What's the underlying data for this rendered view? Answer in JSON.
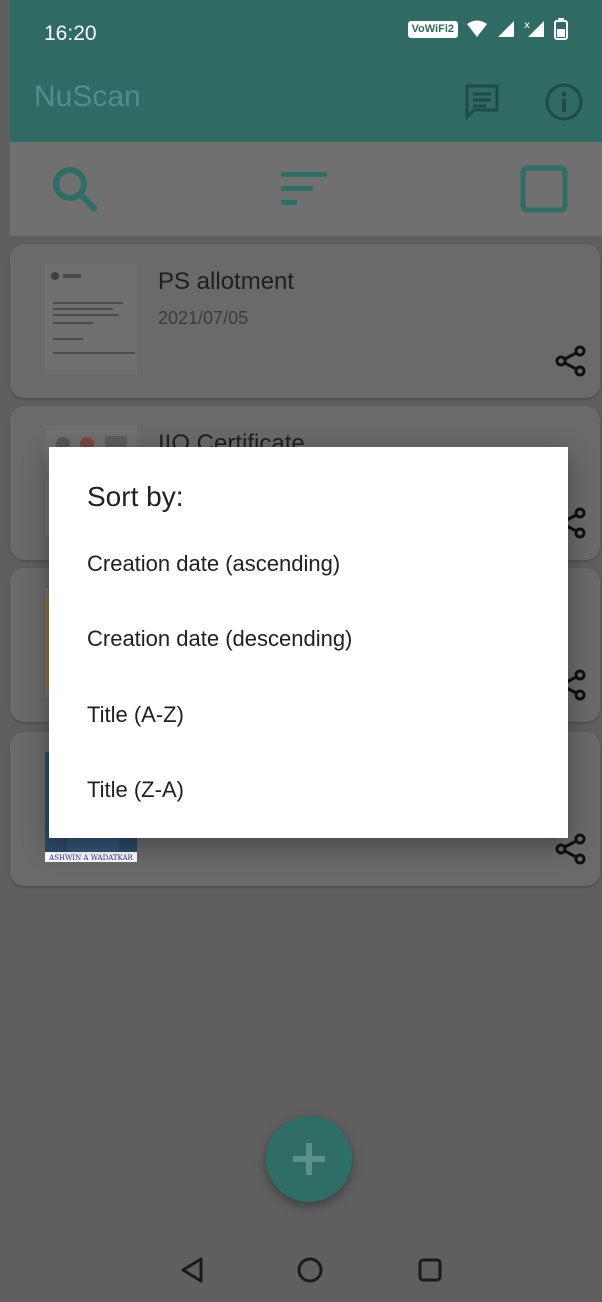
{
  "status_bar": {
    "time": "16:20",
    "vowifi_badge": "VoWiFi2",
    "icons": [
      "wifi-icon",
      "signal-icon",
      "signal-x-icon",
      "battery-icon"
    ]
  },
  "app_bar": {
    "title": "NuScan",
    "actions": [
      "message-icon",
      "info-icon"
    ]
  },
  "toolbar": {
    "actions": [
      "search-icon",
      "sort-icon",
      "checkbox-outline-icon"
    ]
  },
  "documents": [
    {
      "title": "PS allotment",
      "date": "2021/07/05"
    },
    {
      "title": "IIO Certificate",
      "date": ""
    },
    {
      "title": "",
      "date": ""
    },
    {
      "title": "",
      "date": "",
      "thumb_caption": "ASHWIN A WADATKAR"
    }
  ],
  "sort_dialog": {
    "title": "Sort by:",
    "options": [
      "Creation date (ascending)",
      "Creation date (descending)",
      "Title (A-Z)",
      "Title (Z-A)"
    ]
  },
  "fab": {
    "icon": "add-icon"
  },
  "colors": {
    "primary": "#306a65",
    "accent": "#2f6d67",
    "scrim": "#5f5f5f",
    "dialog": "#ffffff"
  }
}
